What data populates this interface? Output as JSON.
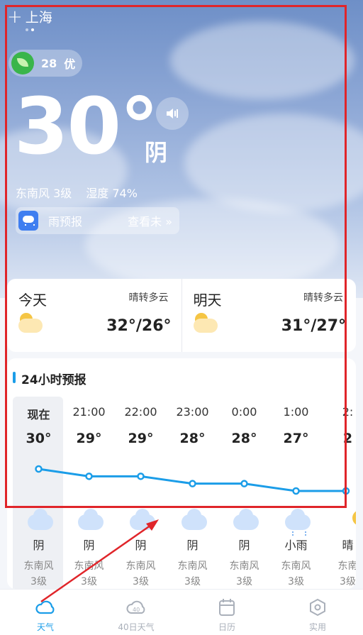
{
  "header": {
    "add_icon": "plus-icon",
    "city": "上海"
  },
  "aqi": {
    "value": "28",
    "level": "优",
    "color": "#3ab54a"
  },
  "current": {
    "temperature": "30°",
    "condition": "阴",
    "wind": "东南风 3级",
    "humidity": "湿度 74%"
  },
  "rain": {
    "label": "雨预报",
    "more": "查看未 »"
  },
  "days": [
    {
      "name": "今天",
      "condition": "晴转多云",
      "range": "32°/26°"
    },
    {
      "name": "明天",
      "condition": "晴转多云",
      "range": "31°/27°"
    }
  ],
  "hourly": {
    "title": "24小时预报",
    "line_color": "#1b9de8",
    "hours": [
      {
        "time": "现在",
        "temp": "30°",
        "weather": "阴",
        "wind_dir": "东南风",
        "wind_level": "3级",
        "icon": "cloud-icon"
      },
      {
        "time": "21:00",
        "temp": "29°",
        "weather": "阴",
        "wind_dir": "东南风",
        "wind_level": "3级",
        "icon": "cloud-icon"
      },
      {
        "time": "22:00",
        "temp": "29°",
        "weather": "阴",
        "wind_dir": "东南风",
        "wind_level": "3级",
        "icon": "cloud-icon"
      },
      {
        "time": "23:00",
        "temp": "28°",
        "weather": "阴",
        "wind_dir": "东南风",
        "wind_level": "3级",
        "icon": "cloud-icon"
      },
      {
        "time": "0:00",
        "temp": "28°",
        "weather": "阴",
        "wind_dir": "东南风",
        "wind_level": "3级",
        "icon": "cloud-icon"
      },
      {
        "time": "1:00",
        "temp": "27°",
        "weather": "小雨",
        "wind_dir": "东南风",
        "wind_level": "3级",
        "icon": "rain-cloud-icon"
      },
      {
        "time": "2:",
        "temp": "2",
        "weather": "晴",
        "wind_dir": "东南",
        "wind_level": "3级",
        "icon": "sun-cloud-icon"
      }
    ],
    "temps_numeric": [
      30,
      29,
      29,
      28,
      28,
      27,
      27
    ]
  },
  "tabs": [
    {
      "label": "天气",
      "icon": "weather-cloud-icon",
      "active": true
    },
    {
      "label": "40日天气",
      "icon": "forty-day-icon",
      "active": false
    },
    {
      "label": "日历",
      "icon": "calendar-icon",
      "active": false
    },
    {
      "label": "实用",
      "icon": "tools-icon",
      "active": false
    }
  ]
}
